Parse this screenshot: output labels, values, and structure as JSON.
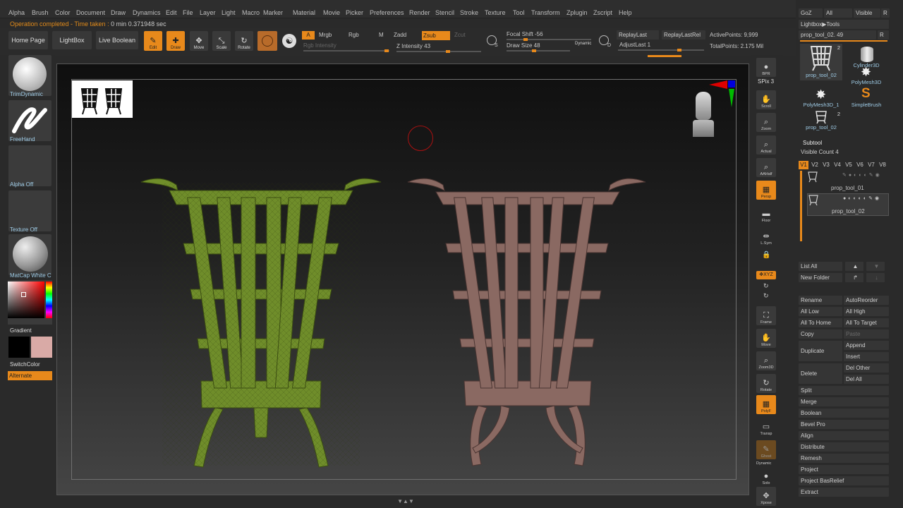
{
  "menubar": [
    "Alpha",
    "Brush",
    "Color",
    "Document",
    "Draw",
    "Dynamics",
    "Edit",
    "File",
    "Layer",
    "Light",
    "Macro",
    "Marker",
    "Material",
    "Movie",
    "Picker",
    "Preferences",
    "Render",
    "Stencil",
    "Stroke",
    "Texture",
    "Tool",
    "Transform",
    "Zplugin",
    "Zscript",
    "Help"
  ],
  "status": {
    "prefix": "Operation completed - Time taken :",
    "time": "0 min 0.371948 sec"
  },
  "toolbar": {
    "home": "Home Page",
    "lightbox": "LightBox",
    "live_boolean": "Live Boolean",
    "edit": "Edit",
    "draw": "Draw",
    "move": "Move",
    "scale": "Scale",
    "rotate": "Rotate",
    "a": "A",
    "mrgb": "Mrgb",
    "rgb": "Rgb",
    "m": "M",
    "zadd": "Zadd",
    "zsub": "Zsub",
    "zcut": "Zcut",
    "rgb_intensity": "Rgb Intensity",
    "z_intensity": "Z Intensity 43",
    "focal_shift": "Focal Shift -56",
    "draw_size": "Draw Size 48",
    "dynamic": "Dynamic",
    "replay_last": "ReplayLast",
    "replay_last_rel": "ReplayLastRel",
    "adjust_last": "AdjustLast 1",
    "active_points": "ActivePoints: 9,999",
    "total_points": "TotalPoints: 2.175 Mil",
    "s": "S",
    "d": "D"
  },
  "leftpanel": {
    "brush": "TrimDynamic",
    "stroke": "FreeHand",
    "alpha": "Alpha Off",
    "texture": "Texture Off",
    "material": "MatCap White C",
    "gradient": "Gradient",
    "switch_color": "SwitchColor",
    "alternate": "Alternate"
  },
  "rightshelf": [
    "BPR",
    "SPix 3",
    "Scroll",
    "Zoom",
    "Actual",
    "AAHalf",
    "Persp",
    "Floor",
    "L.Sym",
    "Frame",
    "Move",
    "Zoom3D",
    "Rotate",
    "PolyF",
    "Transp",
    "Ghost",
    "Dynamic",
    "Solo",
    "Xpose"
  ],
  "rightpanel": {
    "goz": "GoZ",
    "all": "All",
    "visible": "Visible",
    "r": "R",
    "lightbox_tools": "Lightbox▶Tools",
    "prop_tool": "prop_tool_02. 49",
    "r2": "R",
    "tools": [
      {
        "label": "prop_tool_02",
        "count": "2"
      },
      {
        "label": "Cylinder3D"
      },
      {
        "label": "PolyMesh3D"
      },
      {
        "label": "PolyMesh3D_1"
      },
      {
        "label": "SimpleBrush"
      },
      {
        "label": "prop_tool_02",
        "count": "2"
      }
    ],
    "subtool": "Subtool",
    "visible_count": "Visible Count 4",
    "vtabs": [
      "V1",
      "V2",
      "V3",
      "V4",
      "V5",
      "V6",
      "V7",
      "V8"
    ],
    "subtools": [
      "prop_tool_01",
      "prop_tool_02"
    ],
    "list_all": "List All",
    "new_folder": "New Folder",
    "rename": "Rename",
    "auto_reorder": "AutoReorder",
    "all_low": "All Low",
    "all_high": "All High",
    "all_to_home": "All To Home",
    "all_to_target": "All To Target",
    "copy": "Copy",
    "paste": "Paste",
    "duplicate": "Duplicate",
    "append": "Append",
    "insert": "Insert",
    "delete": "Delete",
    "del_other": "Del Other",
    "del_all": "Del All",
    "actions": [
      "Split",
      "Merge",
      "Boolean",
      "Bevel Pro",
      "Align",
      "Distribute",
      "Remesh",
      "Project",
      "Project BasRelief",
      "Extract"
    ]
  },
  "colors": {
    "accent": "#e8891b",
    "green_mesh": "#6f8d2a",
    "clay": "#8a6962",
    "fill_swatch": "#d9aaa6"
  }
}
